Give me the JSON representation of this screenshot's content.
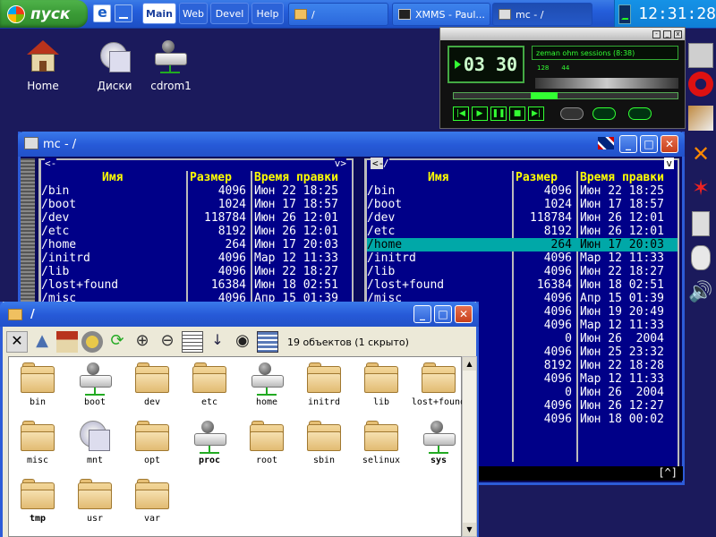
{
  "taskbar": {
    "start_label": "пуск",
    "workspaces": [
      "Main",
      "Web",
      "Devel",
      "Help"
    ],
    "active_workspace": "Main",
    "path_button": "/",
    "tasks": [
      {
        "label": "XMMS - Paul..."
      },
      {
        "label": "mc - /"
      }
    ],
    "clock": "12:31:28"
  },
  "desktop_icons": [
    {
      "label": "Home",
      "icon": "home-icon"
    },
    {
      "label": "Диски",
      "icon": "disks-icon"
    },
    {
      "label": "cdrom1",
      "icon": "network-drive-icon"
    }
  ],
  "xmms": {
    "time": "03 30",
    "title": "zeman ohm sessions (8:38)",
    "kbps": "128",
    "khz": "44"
  },
  "mc": {
    "title": "mc - /",
    "headers": {
      "name": "Имя",
      "size": "Размер",
      "mtime": "Время правки"
    },
    "left_top": "<-",
    "left_arrow": "v>",
    "right_top": "/",
    "right_arrow": "v",
    "left_panel": [
      {
        "name": "/bin",
        "size": "4096",
        "mtime": "Июн 22 18:25"
      },
      {
        "name": "/boot",
        "size": "1024",
        "mtime": "Июн 17 18:57"
      },
      {
        "name": "/dev",
        "size": "118784",
        "mtime": "Июн 26 12:01"
      },
      {
        "name": "/etc",
        "size": "8192",
        "mtime": "Июн 26 12:01"
      },
      {
        "name": "/home",
        "size": "264",
        "mtime": "Июн 17 20:03"
      },
      {
        "name": "/initrd",
        "size": "4096",
        "mtime": "Мар 12 11:33"
      },
      {
        "name": "/lib",
        "size": "4096",
        "mtime": "Июн 22 18:27"
      },
      {
        "name": "/lost+found",
        "size": "16384",
        "mtime": "Июн 18 02:51"
      },
      {
        "name": "/misc",
        "size": "4096",
        "mtime": "Апр 15 01:39"
      }
    ],
    "right_panel": [
      {
        "name": "/bin",
        "size": "4096",
        "mtime": "Июн 22 18:25"
      },
      {
        "name": "/boot",
        "size": "1024",
        "mtime": "Июн 17 18:57"
      },
      {
        "name": "/dev",
        "size": "118784",
        "mtime": "Июн 26 12:01"
      },
      {
        "name": "/etc",
        "size": "8192",
        "mtime": "Июн 26 12:01"
      },
      {
        "name": "/home",
        "size": "264",
        "mtime": "Июн 17 20:03"
      },
      {
        "name": "/initrd",
        "size": "4096",
        "mtime": "Мар 12 11:33"
      },
      {
        "name": "/lib",
        "size": "4096",
        "mtime": "Июн 22 18:27"
      },
      {
        "name": "/lost+found",
        "size": "16384",
        "mtime": "Июн 18 02:51"
      },
      {
        "name": "/misc",
        "size": "4096",
        "mtime": "Апр 15 01:39"
      },
      {
        "name": "",
        "size": "4096",
        "mtime": "Июн 19 20:49"
      },
      {
        "name": "",
        "size": "4096",
        "mtime": "Мар 12 11:33"
      },
      {
        "name": "",
        "size": "0",
        "mtime": "Июн 26  2004"
      },
      {
        "name": "",
        "size": "4096",
        "mtime": "Июн 25 23:32"
      },
      {
        "name": "",
        "size": "8192",
        "mtime": "Июн 22 18:28"
      },
      {
        "name": "",
        "size": "4096",
        "mtime": "Мар 12 11:33"
      },
      {
        "name": "",
        "size": "0",
        "mtime": "Июн 26  2004"
      },
      {
        "name": "",
        "size": "4096",
        "mtime": "Июн 26 12:27"
      },
      {
        "name": "",
        "size": "4096",
        "mtime": "Июн 18 00:02"
      }
    ],
    "selected_row": 4,
    "cmdline_right": "[^]"
  },
  "filemanager": {
    "title": "/",
    "status": "19 объектов (1 скрыто)",
    "items": [
      {
        "name": "bin",
        "icon": "folder-icon",
        "bold": false
      },
      {
        "name": "boot",
        "icon": "network-drive-icon",
        "bold": false
      },
      {
        "name": "dev",
        "icon": "folder-icon",
        "bold": false
      },
      {
        "name": "etc",
        "icon": "folder-icon",
        "bold": false
      },
      {
        "name": "home",
        "icon": "network-drive-icon",
        "bold": false
      },
      {
        "name": "initrd",
        "icon": "folder-icon",
        "bold": false
      },
      {
        "name": "lib",
        "icon": "folder-icon",
        "bold": false
      },
      {
        "name": "lost+found",
        "icon": "folder-icon",
        "bold": false
      },
      {
        "name": "misc",
        "icon": "folder-icon",
        "bold": false
      },
      {
        "name": "mnt",
        "icon": "cd-drive-icon",
        "bold": false
      },
      {
        "name": "opt",
        "icon": "folder-icon",
        "bold": false
      },
      {
        "name": "proc",
        "icon": "network-drive-icon",
        "bold": true
      },
      {
        "name": "root",
        "icon": "folder-icon",
        "bold": false
      },
      {
        "name": "sbin",
        "icon": "folder-icon",
        "bold": false
      },
      {
        "name": "selinux",
        "icon": "folder-icon",
        "bold": false
      },
      {
        "name": "sys",
        "icon": "network-drive-icon",
        "bold": true
      },
      {
        "name": "tmp",
        "icon": "folder-icon",
        "bold": true
      },
      {
        "name": "usr",
        "icon": "folder-icon",
        "bold": false
      },
      {
        "name": "var",
        "icon": "folder-icon",
        "bold": false
      }
    ]
  },
  "colors": {
    "desktop": "#1b1a5c",
    "mc_panel": "#000088",
    "mc_header": "#ffff00",
    "mc_selection": "#00a8a8",
    "xp_blue": "#245edb"
  }
}
